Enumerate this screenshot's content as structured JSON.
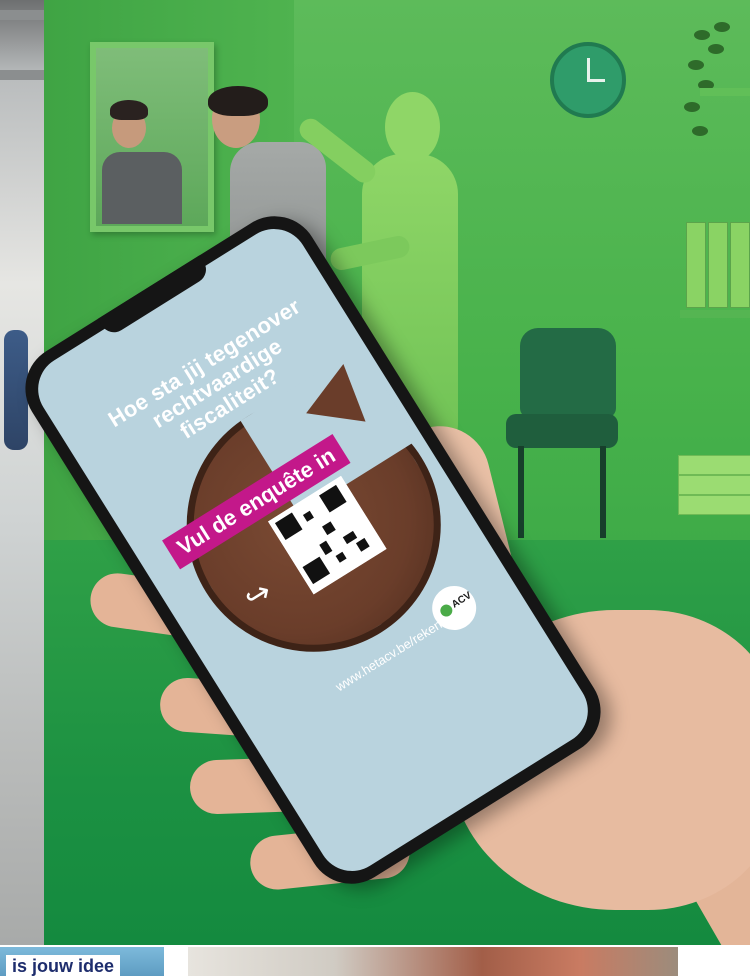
{
  "phone_ad": {
    "headline": "Hoe sta jij tegenover rechtvaardige fiscaliteit?",
    "cta": "Vul de enquête in",
    "url": "www.hetacv.be/rekenfiscaal",
    "logo_text": "ACV"
  },
  "thumbnail_caption": "is jouw idee",
  "colors": {
    "room_green": "#48b24b",
    "cta_magenta": "#c3188a",
    "screen_blue": "#b9d3de",
    "pie_brown": "#6a3d2a"
  }
}
